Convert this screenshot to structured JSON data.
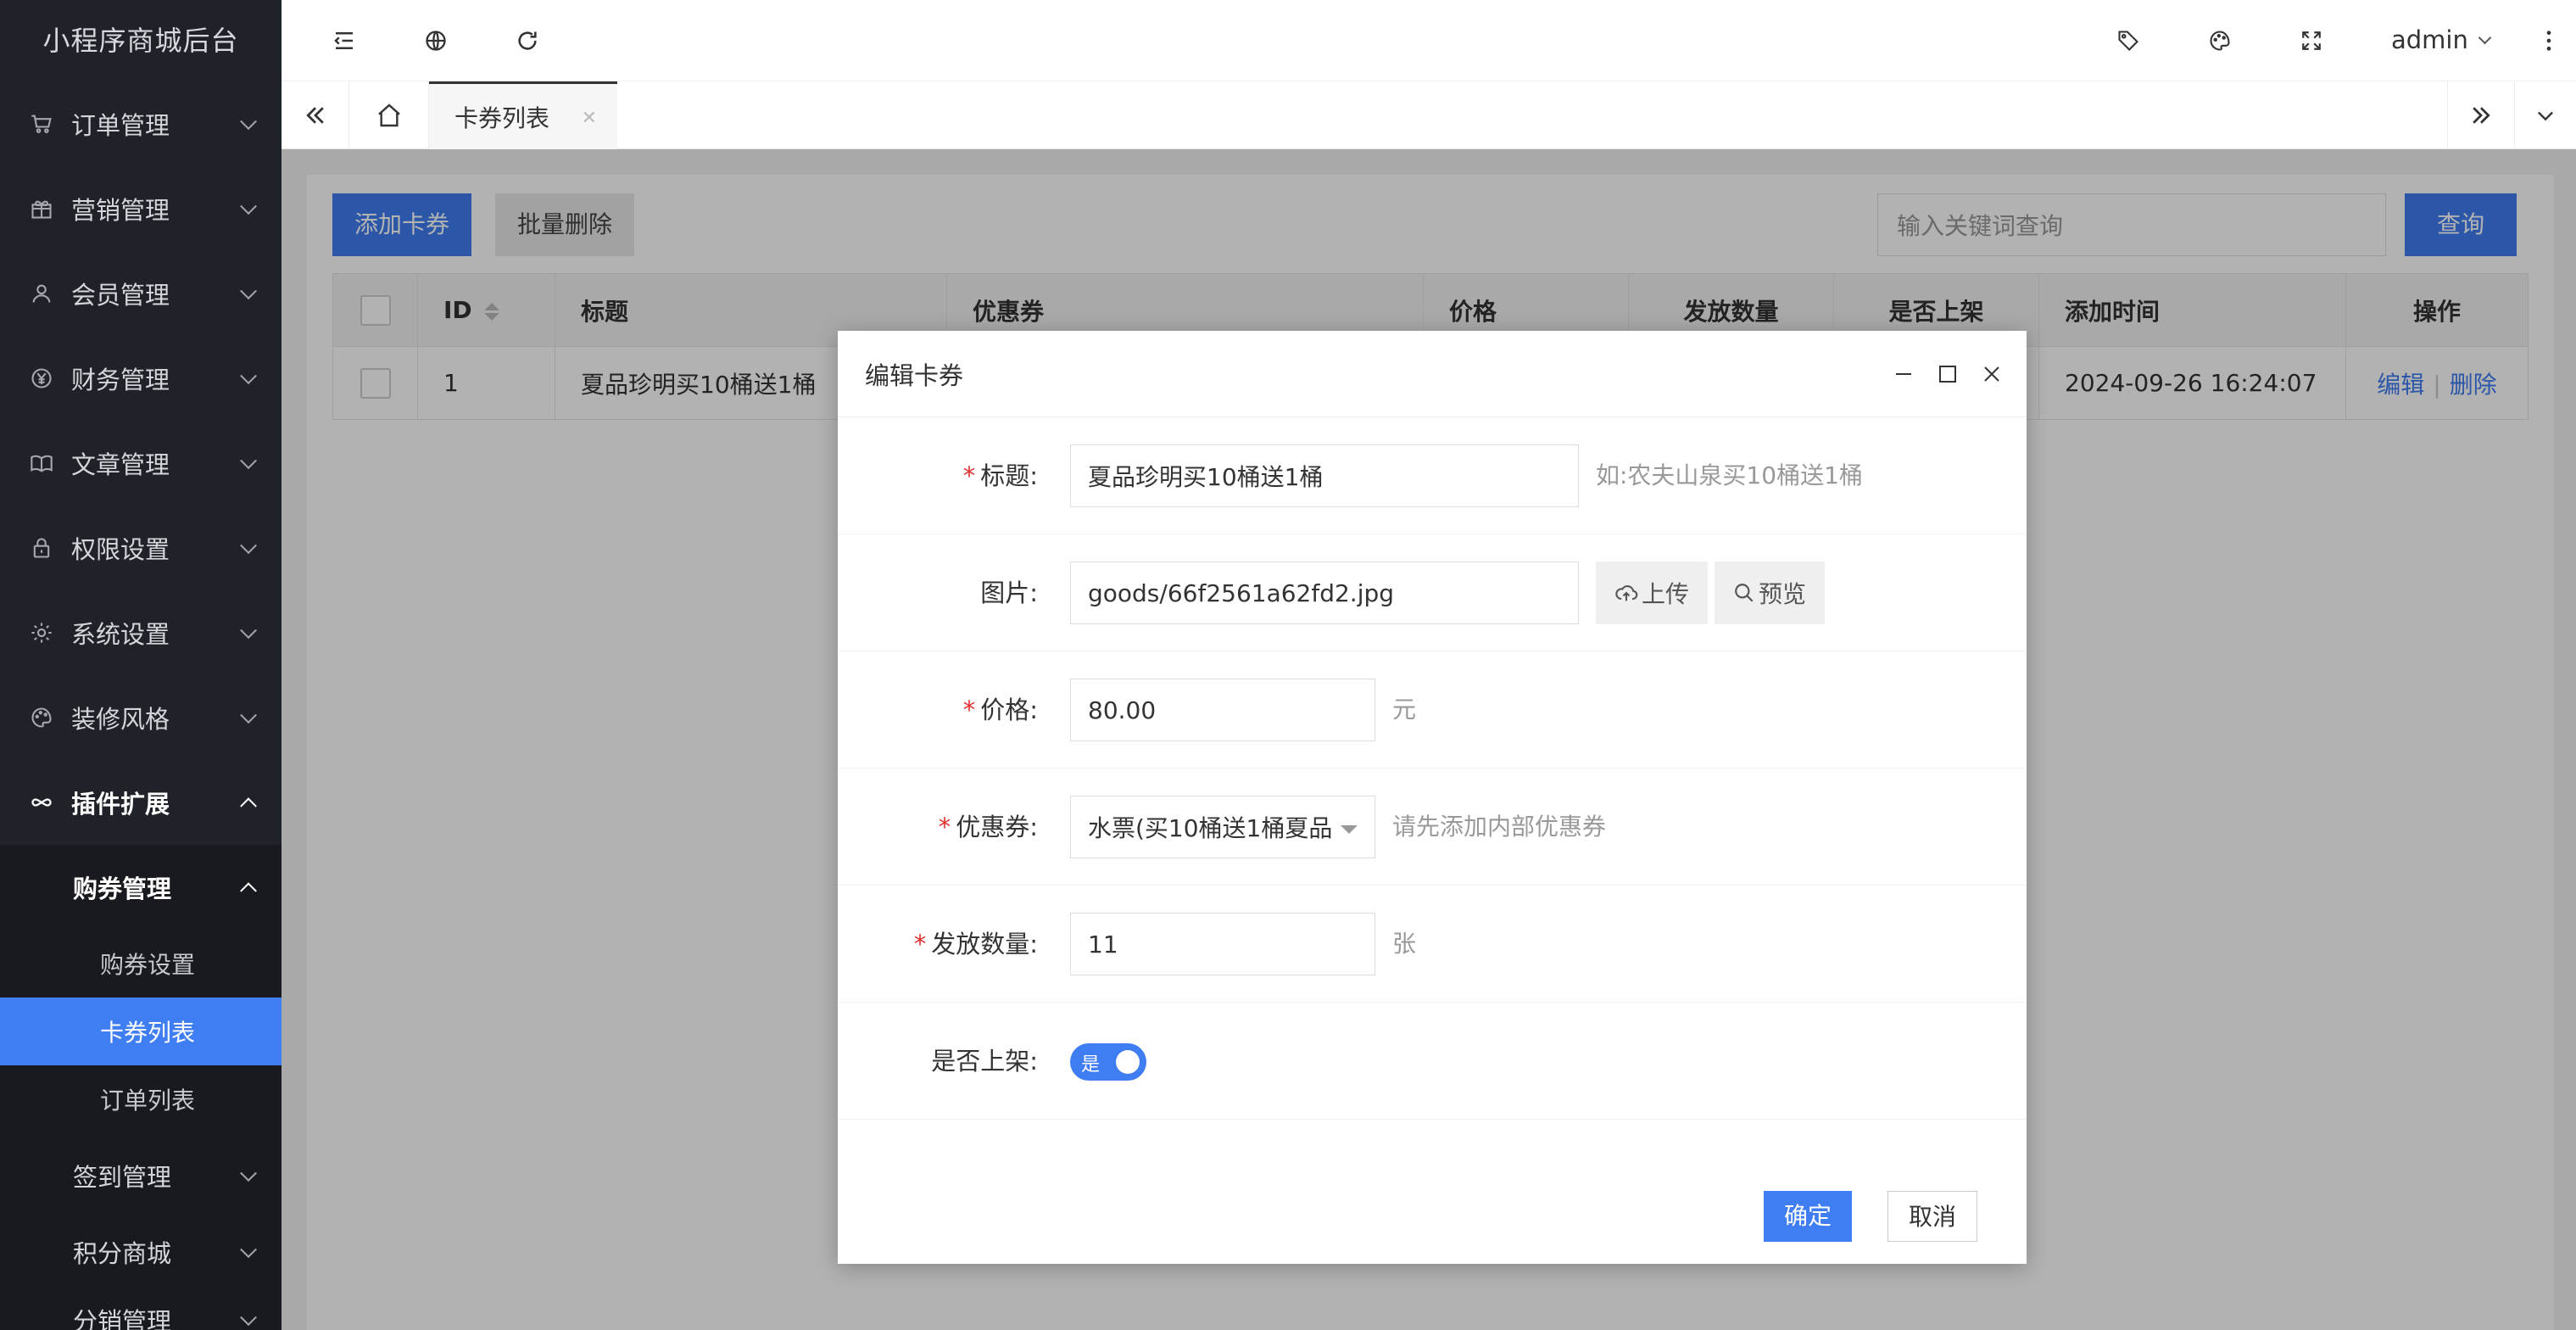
{
  "app": {
    "title": "小程序商城后台"
  },
  "sidebar": {
    "items": [
      {
        "label": "订单管理",
        "icon": "cart-icon"
      },
      {
        "label": "营销管理",
        "icon": "gift-icon"
      },
      {
        "label": "会员管理",
        "icon": "user-icon"
      },
      {
        "label": "财务管理",
        "icon": "yen-icon"
      },
      {
        "label": "文章管理",
        "icon": "book-icon"
      },
      {
        "label": "权限设置",
        "icon": "lock-icon"
      },
      {
        "label": "系统设置",
        "icon": "gear-icon"
      },
      {
        "label": "装修风格",
        "icon": "palette-icon"
      },
      {
        "label": "插件扩展",
        "icon": "infinity-icon"
      }
    ],
    "open_group": {
      "label": "购券管理"
    },
    "leaves": [
      "购券设置",
      "卡券列表",
      "订单列表"
    ],
    "after": [
      "签到管理",
      "积分商城",
      "分销管理"
    ]
  },
  "header": {
    "user": "admin"
  },
  "tabs": {
    "current": "卡券列表"
  },
  "toolbar": {
    "add_label": "添加卡券",
    "batch_delete_label": "批量删除",
    "search_placeholder": "输入关键词查询",
    "query_label": "查询"
  },
  "table": {
    "headers": [
      "ID",
      "标题",
      "优惠券",
      "价格",
      "发放数量",
      "是否上架",
      "添加时间",
      "操作"
    ],
    "rows": [
      {
        "id": "1",
        "title": "夏品珍明买10桶送1桶",
        "time": "2024-09-26 16:24:07"
      }
    ],
    "edit_label": "编辑",
    "delete_label": "删除"
  },
  "modal": {
    "title": "编辑卡券",
    "fields": {
      "title_label": "标题:",
      "title_value": "夏品珍明买10桶送1桶",
      "title_hint": "如:农夫山泉买10桶送1桶",
      "image_label": "图片:",
      "image_value": "goods/66f2561a62fd2.jpg",
      "upload_label": "上传",
      "preview_label": "预览",
      "price_label": "价格:",
      "price_value": "80.00",
      "price_unit": "元",
      "coupon_label": "优惠券:",
      "coupon_value": "水票(买10桶送1桶夏品",
      "coupon_hint": "请先添加内部优惠券",
      "qty_label": "发放数量:",
      "qty_value": "11",
      "qty_unit": "张",
      "shelf_label": "是否上架:",
      "shelf_toggle_text": "是"
    },
    "ok_label": "确定",
    "cancel_label": "取消"
  },
  "colors": {
    "accent": "#3f7df2",
    "sidebar_bg": "#20222a",
    "required": "#e0312d"
  }
}
